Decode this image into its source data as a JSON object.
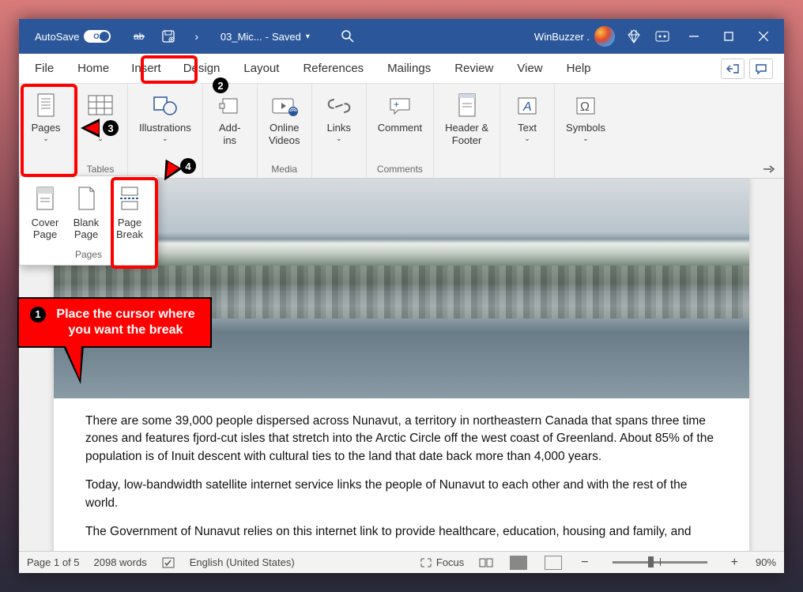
{
  "titlebar": {
    "autosave": "AutoSave",
    "autosave_state": "On",
    "filename": "03_Mic...",
    "save_status": "Saved",
    "username": "WinBuzzer ."
  },
  "tabs": {
    "file": "File",
    "home": "Home",
    "insert": "Insert",
    "design": "Design",
    "layout": "Layout",
    "references": "References",
    "mailings": "Mailings",
    "review": "Review",
    "view": "View",
    "help": "Help"
  },
  "ribbon": {
    "pages": "Pages",
    "tables": "Tables",
    "illustrations": "Illustrations",
    "addins": "Add-\nins",
    "online_videos": "Online\nVideos",
    "media": "Media",
    "links": "Links",
    "comment": "Comment",
    "comments": "Comments",
    "header_footer": "Header &\nFooter",
    "text": "Text",
    "symbols": "Symbols"
  },
  "pages_panel": {
    "cover_page": "Cover\nPage",
    "blank_page": "Blank\nPage",
    "page_break": "Page\nBreak",
    "label": "Pages"
  },
  "document": {
    "p1": "There are some 39,000 people dispersed across Nunavut, a territory in northeastern Canada that spans three time zones and features fjord-cut isles that stretch into the Arctic Circle off the west coast of Greenland. About 85% of the population is of Inuit descent with cultural ties to the land that date back more than 4,000 years.",
    "p2": "Today, low-bandwidth satellite internet service links the people of Nunavut to each other and with the rest of the world.",
    "p3": "The Government of Nunavut relies on this internet link to provide healthcare, education, housing and family, and"
  },
  "callout": {
    "text": "Place the cursor where you want the break"
  },
  "badges": {
    "b1": "1",
    "b2": "2",
    "b3": "3",
    "b4": "4"
  },
  "statusbar": {
    "page": "Page 1 of 5",
    "words": "2098 words",
    "lang": "English (United States)",
    "focus": "Focus",
    "zoom": "90%"
  }
}
